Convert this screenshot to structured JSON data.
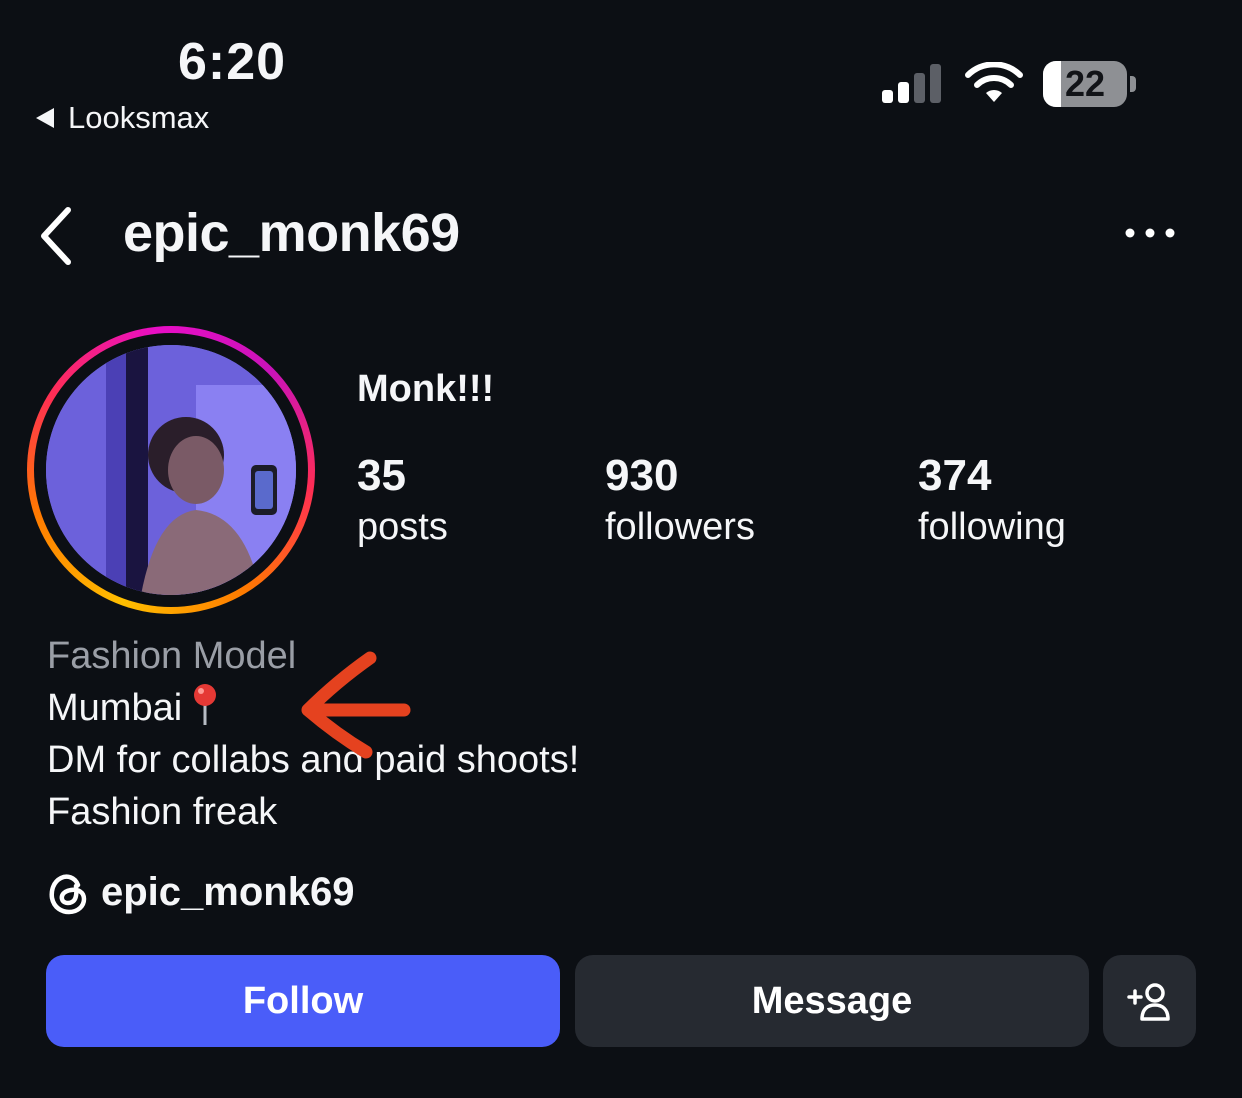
{
  "status_bar": {
    "time": "6:20",
    "back_app_label": "Looksmax",
    "battery_level": "22",
    "battery_fraction": 0.22,
    "icons": [
      "signal-icon",
      "wifi-icon",
      "battery-icon"
    ]
  },
  "header": {
    "username": "epic_monk69",
    "icons": [
      "chevron-left-icon",
      "more-horizontal-icon"
    ]
  },
  "profile": {
    "display_name": "Monk!!!",
    "stats": [
      {
        "count": "35",
        "label": "posts"
      },
      {
        "count": "930",
        "label": "followers"
      },
      {
        "count": "374",
        "label": "following"
      }
    ],
    "bio": {
      "category": "Fashion Model",
      "lines": [
        "Mumbai",
        "DM for collabs and paid shoots!",
        "Fashion freak"
      ],
      "location_emoji": "round-pushpin-icon"
    },
    "threads_handle": "epic_monk69"
  },
  "actions": {
    "follow_label": "Follow",
    "message_label": "Message",
    "add_user_icon": "add-person-icon"
  },
  "colors": {
    "background": "#0c0f14",
    "follow_button": "#4a5df9",
    "secondary_button": "#262a31",
    "category_text": "#9a9ea6",
    "annotation_arrow": "#e5421f"
  }
}
